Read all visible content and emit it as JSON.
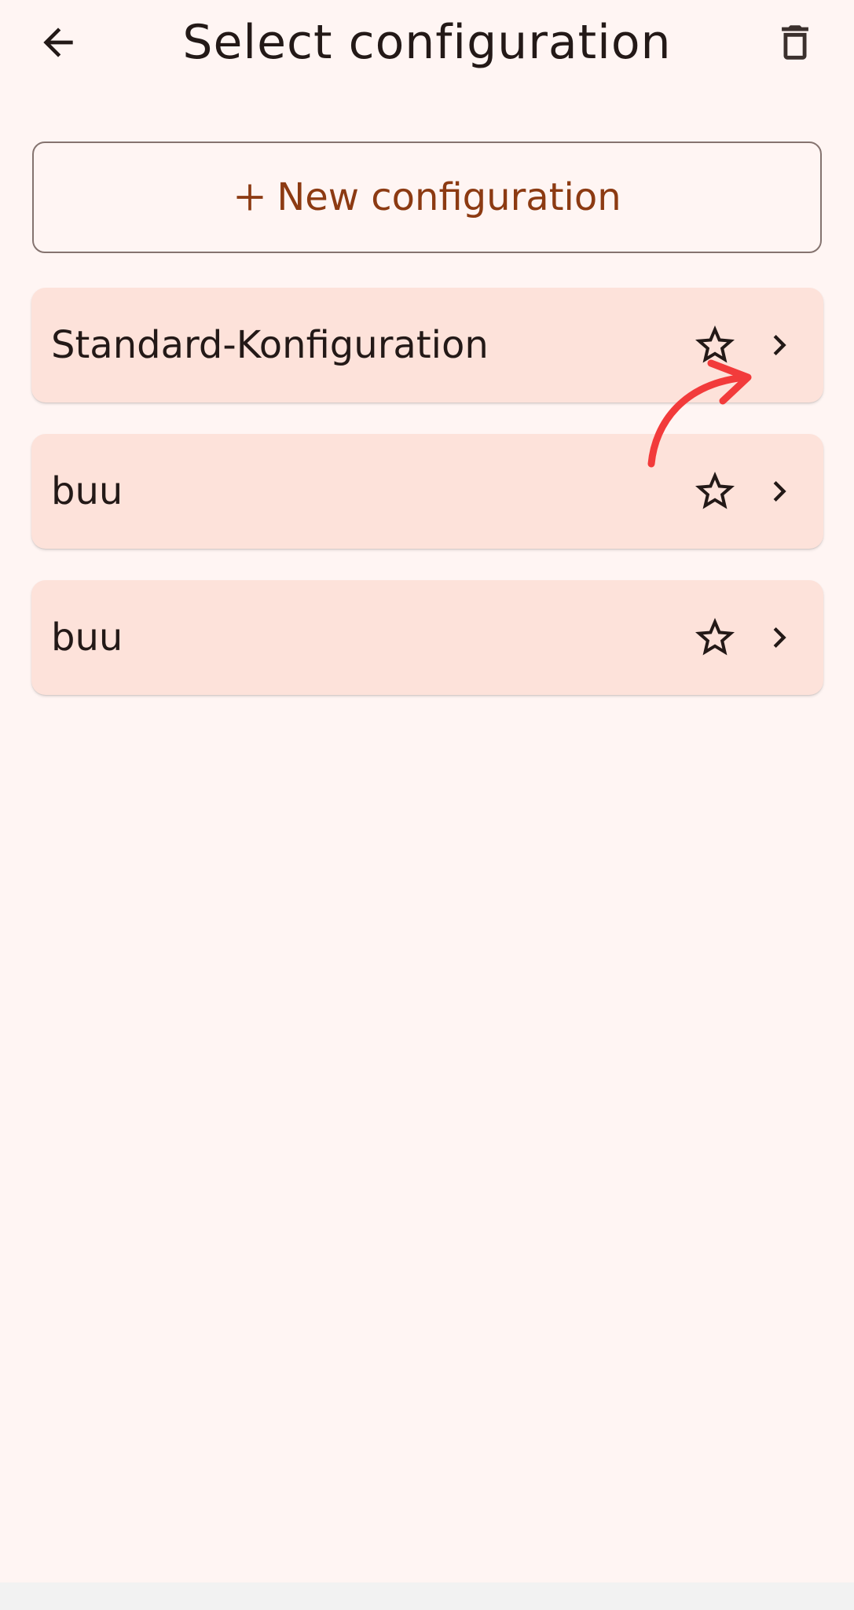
{
  "header": {
    "title": "Select configuration",
    "back_icon": "arrow-back-icon",
    "delete_icon": "trash-icon"
  },
  "new_config": {
    "label": "New configuration",
    "icon": "plus-icon"
  },
  "configurations": [
    {
      "name": "Standard-Konfiguration",
      "favorite": false
    },
    {
      "name": "buu",
      "favorite": false
    },
    {
      "name": "buu",
      "favorite": false
    }
  ],
  "colors": {
    "background": "#fff5f3",
    "card": "#fde2da",
    "accent": "#8c3a12",
    "outline": "#85736f",
    "annotation": "#f23b3b"
  }
}
